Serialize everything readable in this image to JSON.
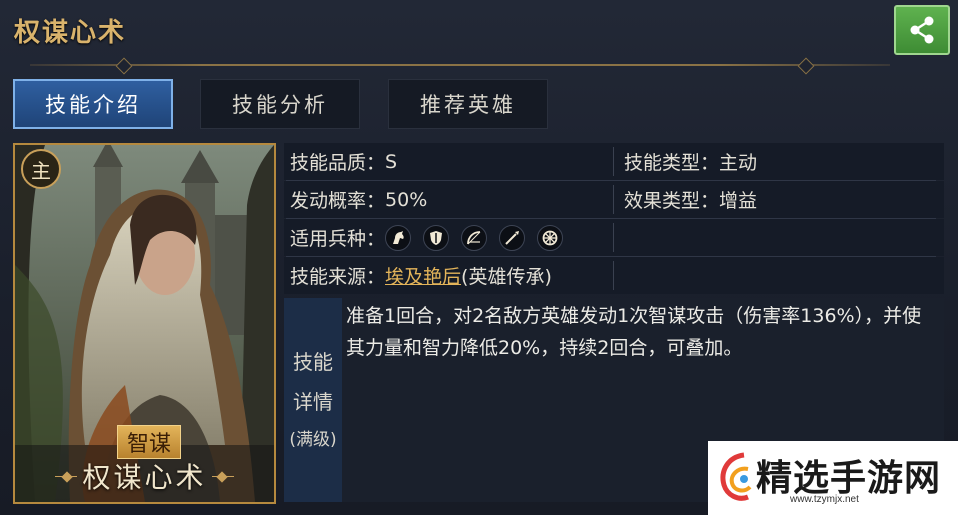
{
  "header": {
    "title": "权谋心术"
  },
  "tabs": [
    {
      "label": "技能介绍",
      "active": true
    },
    {
      "label": "技能分析",
      "active": false
    },
    {
      "label": "推荐英雄",
      "active": false
    }
  ],
  "card": {
    "main_badge": "主",
    "type_badge": "智谋",
    "name": "权谋心术"
  },
  "info": {
    "quality_label": "技能品质：",
    "quality_value": "S",
    "skill_type_label": "技能类型：",
    "skill_type_value": "主动",
    "rate_label": "发动概率：",
    "rate_value": "50%",
    "effect_type_label": "效果类型：",
    "effect_type_value": "增益",
    "troops_label": "适用兵种：",
    "troop_icons": [
      "horse-icon",
      "shield-icon",
      "bow-icon",
      "spear-icon",
      "wheel-icon"
    ],
    "source_label": "技能来源：",
    "source_link": "埃及艳后",
    "source_suffix": "(英雄传承)"
  },
  "detail": {
    "label_line1": "技能",
    "label_line2": "详情",
    "label_line3": "(满级)",
    "text": "准备1回合，对2名敌方英雄发动1次智谋攻击（伤害率136%），并使其力量和智力降低20%，持续2回合，可叠加。"
  },
  "watermark": {
    "text": "精选手游网",
    "url": "www.tzymjx.net"
  },
  "colors": {
    "accent_gold": "#d9b36c",
    "tab_active": "#2f5fa0",
    "share_green": "#4fa042"
  }
}
